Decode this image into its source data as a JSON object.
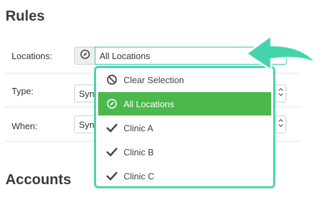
{
  "sections": {
    "rules_title": "Rules",
    "accounts_title": "Accounts"
  },
  "fields": {
    "locations": {
      "label": "Locations:",
      "value": "All Locations",
      "icon": "compass-icon"
    },
    "type": {
      "label": "Type:",
      "value": "Syn"
    },
    "when": {
      "label": "When:",
      "value": "Syn"
    }
  },
  "dropdown": {
    "items": [
      {
        "label": "Clear Selection",
        "icon": "ban-icon",
        "selected": false
      },
      {
        "label": "All Locations",
        "icon": "compass-icon",
        "selected": true
      },
      {
        "label": "Clinic A",
        "icon": "check-icon",
        "selected": false
      },
      {
        "label": "Clinic B",
        "icon": "check-icon",
        "selected": false
      },
      {
        "label": "Clinic C",
        "icon": "check-icon",
        "selected": false
      }
    ]
  },
  "colors": {
    "accent_green": "#4cb84c",
    "highlight_teal": "#45d5ae",
    "focus_border": "#35c6a6"
  }
}
